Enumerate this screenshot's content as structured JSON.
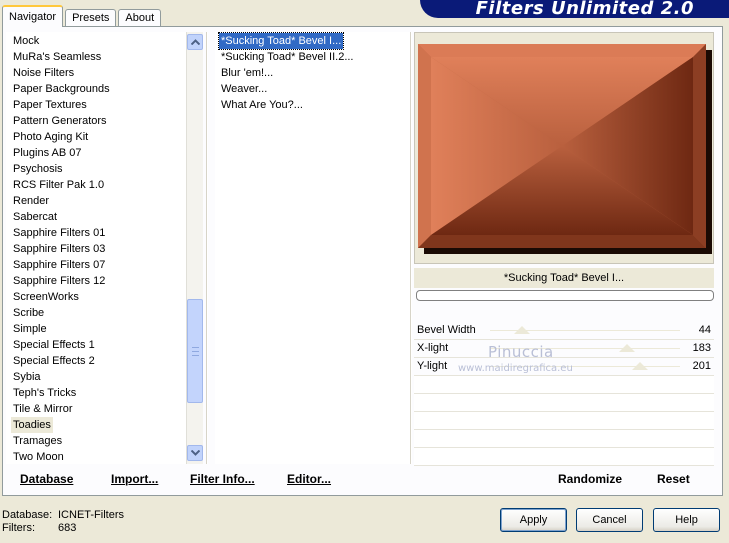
{
  "tabs": [
    {
      "label": "Navigator",
      "active": true
    },
    {
      "label": "Presets",
      "active": false
    },
    {
      "label": "About",
      "active": false
    }
  ],
  "banner_title": "Filters Unlimited 2.0",
  "categories": [
    "Mock",
    "MuRa's Seamless",
    "Noise Filters",
    "Paper Backgrounds",
    "Paper Textures",
    "Pattern Generators",
    "Photo Aging Kit",
    "Plugins AB 07",
    "Psychosis",
    "RCS Filter Pak 1.0",
    "Render",
    "Sabercat",
    "Sapphire Filters 01",
    "Sapphire Filters 03",
    "Sapphire Filters 07",
    "Sapphire Filters 12",
    "ScreenWorks",
    "Scribe",
    "Simple",
    "Special Effects 1",
    "Special Effects 2",
    "Sybia",
    "Teph's Tricks",
    "Tile & Mirror",
    "Toadies",
    "Tramages",
    "Two Moon"
  ],
  "selected_category": "Toadies",
  "filters": [
    "*Sucking Toad*  Bevel I...",
    "*Sucking Toad*  Bevel II.2...",
    "Blur 'em!...",
    "Weaver...",
    "What Are You?..."
  ],
  "selected_filter": "*Sucking Toad*  Bevel I...",
  "preview_colors": {
    "light": "#e0805a",
    "mid": "#b9603e",
    "dark": "#6e2812",
    "shadow": "#1a0a04"
  },
  "filter_title": "*Sucking Toad*  Bevel I...",
  "params": [
    {
      "label": "Bevel Width",
      "value": "44",
      "level": 0.17
    },
    {
      "label": "X-light",
      "value": "183",
      "level": 0.72
    },
    {
      "label": "Y-light",
      "value": "201",
      "level": 0.79
    }
  ],
  "watermark": {
    "name": "Pinuccia",
    "url": "www.maidiregrafica.eu"
  },
  "toolbar": {
    "database": "Database",
    "import": "Import...",
    "filter_info": "Filter Info...",
    "editor": "Editor...",
    "randomize": "Randomize",
    "reset": "Reset"
  },
  "footer": {
    "database_label": "Database:",
    "database_value": "ICNET-Filters",
    "filters_label": "Filters:",
    "filters_value": "683"
  },
  "buttons": {
    "apply": "Apply",
    "cancel": "Cancel",
    "help": "Help"
  }
}
